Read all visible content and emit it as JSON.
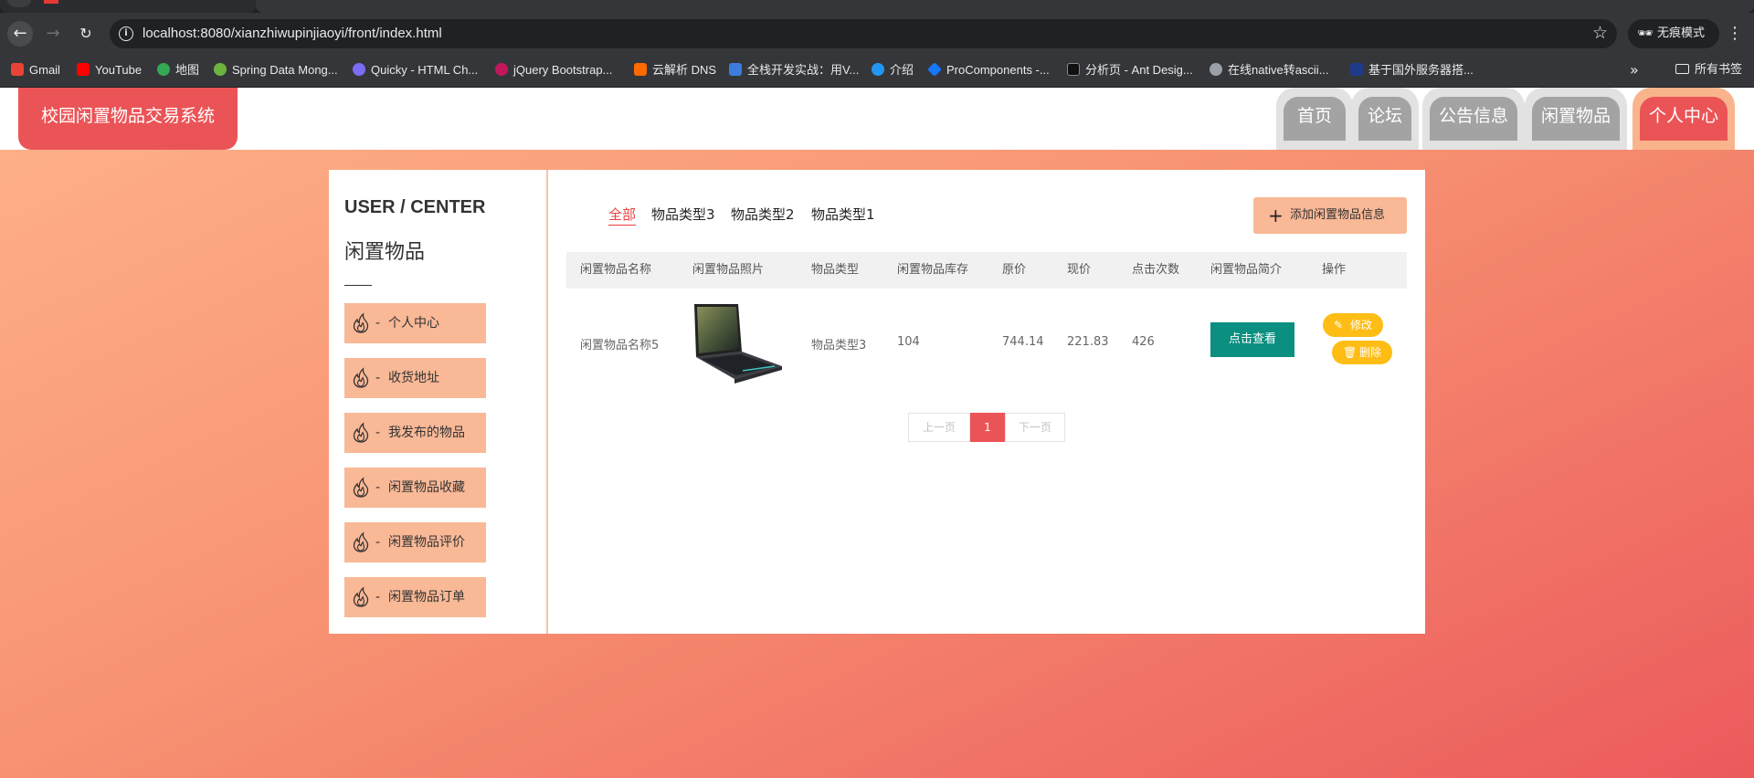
{
  "browser": {
    "url": "localhost:8080/xianzhiwupinjiaoyi/front/index.html",
    "incognito_label": "无痕模式",
    "bookmarks": [
      {
        "label": "Gmail",
        "color": "#ea4335"
      },
      {
        "label": "YouTube",
        "color": "#ff0000"
      },
      {
        "label": "地图",
        "color": "#34a853"
      },
      {
        "label": "Spring Data Mong...",
        "color": "#6db33f"
      },
      {
        "label": "Quicky - HTML Ch...",
        "color": "#7b6cf6"
      },
      {
        "label": "jQuery Bootstrap...",
        "color": "#c2185b"
      },
      {
        "label": "云解析 DNS",
        "color": "#ff6a00"
      },
      {
        "label": "全栈开发实战：用V...",
        "color": "#3b7ddd"
      },
      {
        "label": "介绍",
        "color": "#2196f3"
      },
      {
        "label": "ProComponents -...",
        "color": "#1677ff"
      },
      {
        "label": "分析页 - Ant Desig...",
        "color": "#111111"
      },
      {
        "label": "在线native转ascii...",
        "color": "#9aa0a6"
      },
      {
        "label": "基于国外服务器搭...",
        "color": "#1e3a8a"
      }
    ],
    "all_bookmarks_label": "所有书签"
  },
  "header": {
    "site_title": "校园闲置物品交易系统",
    "nav": [
      "首页",
      "论坛",
      "公告信息",
      "闲置物品",
      "个人中心"
    ],
    "active_nav": "个人中心"
  },
  "sidebar": {
    "title_en": "USER / CENTER",
    "title_cn": "闲置物品",
    "items": [
      "个人中心",
      "收货地址",
      "我发布的物品",
      "闲置物品收藏",
      "闲置物品评价",
      "闲置物品订单"
    ]
  },
  "main": {
    "categories": [
      "全部",
      "物品类型3",
      "物品类型2",
      "物品类型1"
    ],
    "active_category": "全部",
    "add_button": "添加闲置物品信息",
    "columns": [
      "闲置物品名称",
      "闲置物品照片",
      "物品类型",
      "闲置物品库存",
      "原价",
      "现价",
      "点击次数",
      "闲置物品简介",
      "操作"
    ],
    "rows": [
      {
        "name": "闲置物品名称5",
        "type": "物品类型3",
        "stock": "104",
        "original_price": "744.14",
        "current_price": "221.83",
        "clicks": "426",
        "view_button": "点击查看",
        "edit_button": "修改",
        "delete_button": "删除"
      }
    ],
    "pagination": {
      "prev": "上一页",
      "current": "1",
      "next": "下一页"
    }
  },
  "colors": {
    "accent": "#eb5457",
    "peach": "#f9b896",
    "teal": "#0a8f80",
    "yellow": "#fdbd14"
  }
}
